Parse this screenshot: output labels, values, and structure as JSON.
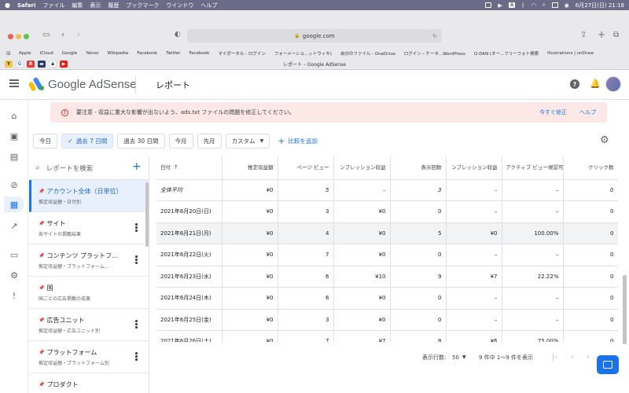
{
  "menubar": {
    "app": "Safari",
    "items": [
      "ファイル",
      "編集",
      "表示",
      "履歴",
      "ブックマーク",
      "ウインドウ",
      "ヘルプ"
    ],
    "clock": "6月27日(日)  21:18",
    "input_indicator": "A"
  },
  "safari": {
    "url": "google.com",
    "bookmarks": [
      "Apple",
      "iCloud",
      "Google",
      "Yahoo",
      "Wikipedia",
      "Facebook",
      "Twitter",
      "Facebook",
      "マイポータル - ログイン",
      "フォーメーショ...ットウィキ)",
      "自分のファイル - OneDrive",
      "ログイン ‹ ケーキ...WordPress",
      "O-DAN (オー...フリーフォト検索",
      "Illustrations | unDraw"
    ],
    "tab_title": "レポート – Google AdSense"
  },
  "header": {
    "logo_text": "Google AdSense",
    "title": "レポート"
  },
  "alert": {
    "message": "要注意 - 収益に重大な影響が出ないよう、ads.txt ファイルの問題を修正してください。",
    "fix_label": "今すぐ修正",
    "help_label": "ヘルプ"
  },
  "date_ranges": [
    {
      "label": "今日",
      "active": false
    },
    {
      "label": "過去 7 日間",
      "active": true
    },
    {
      "label": "過去 30 日間",
      "active": false
    },
    {
      "label": "今月",
      "active": false
    },
    {
      "label": "先月",
      "active": false
    }
  ],
  "custom_label": "カスタム",
  "compare_label": "比較を追加",
  "search": {
    "placeholder": "レポートを検索"
  },
  "reports": [
    {
      "title": "アカウント全体（日単位）",
      "subtitle": "推定収益額・日付別",
      "active": true
    },
    {
      "title": "サイト",
      "subtitle": "各サイトの掲載結果",
      "active": false
    },
    {
      "title": "コンテンツ プラットフ...",
      "subtitle": "推定収益額・プラットフォーム...",
      "active": false
    },
    {
      "title": "国",
      "subtitle": "国ごとの広告掲載の成果",
      "active": false
    },
    {
      "title": "広告ユニット",
      "subtitle": "推定収益額・広告ユニット別",
      "active": false
    },
    {
      "title": "プラットフォーム",
      "subtitle": "推定収益額・プラットフォーム別",
      "active": false
    },
    {
      "title": "プロダクト",
      "subtitle": "",
      "active": false
    }
  ],
  "table": {
    "headers": [
      "日付",
      "推定収益額",
      "ページ ビュー",
      "ンプレッション収益",
      "表示回数",
      "ンプレッション収益",
      "アクティブ ビュー視認可能率",
      "クリック数"
    ],
    "average_row": [
      "全体平均",
      "¥0",
      "5",
      "–",
      "3",
      "–",
      "–",
      "0"
    ],
    "rows": [
      [
        "2021年6月20日(日)",
        "¥0",
        "3",
        "¥0",
        "0",
        "–",
        "–",
        "0"
      ],
      [
        "2021年6月21日(月)",
        "¥0",
        "4",
        "¥0",
        "5",
        "¥0",
        "100.00%",
        "0"
      ],
      [
        "2021年6月22日(火)",
        "¥0",
        "7",
        "¥0",
        "0",
        "–",
        "–",
        "0"
      ],
      [
        "2021年6月23日(水)",
        "¥0",
        "6",
        "¥10",
        "9",
        "¥7",
        "22.22%",
        "0"
      ],
      [
        "2021年6月24日(木)",
        "¥0",
        "6",
        "¥0",
        "0",
        "–",
        "–",
        "0"
      ],
      [
        "2021年6月25日(金)",
        "¥0",
        "3",
        "¥0",
        "0",
        "–",
        "–",
        "0"
      ],
      [
        "2021年6月26日(土)",
        "¥0",
        "7",
        "¥7",
        "8",
        "¥6",
        "75.00%",
        "0"
      ]
    ]
  },
  "pager": {
    "rows_label": "表示行数:",
    "rows_value": "50",
    "range": "9 件中 1〜9 件を表示"
  }
}
